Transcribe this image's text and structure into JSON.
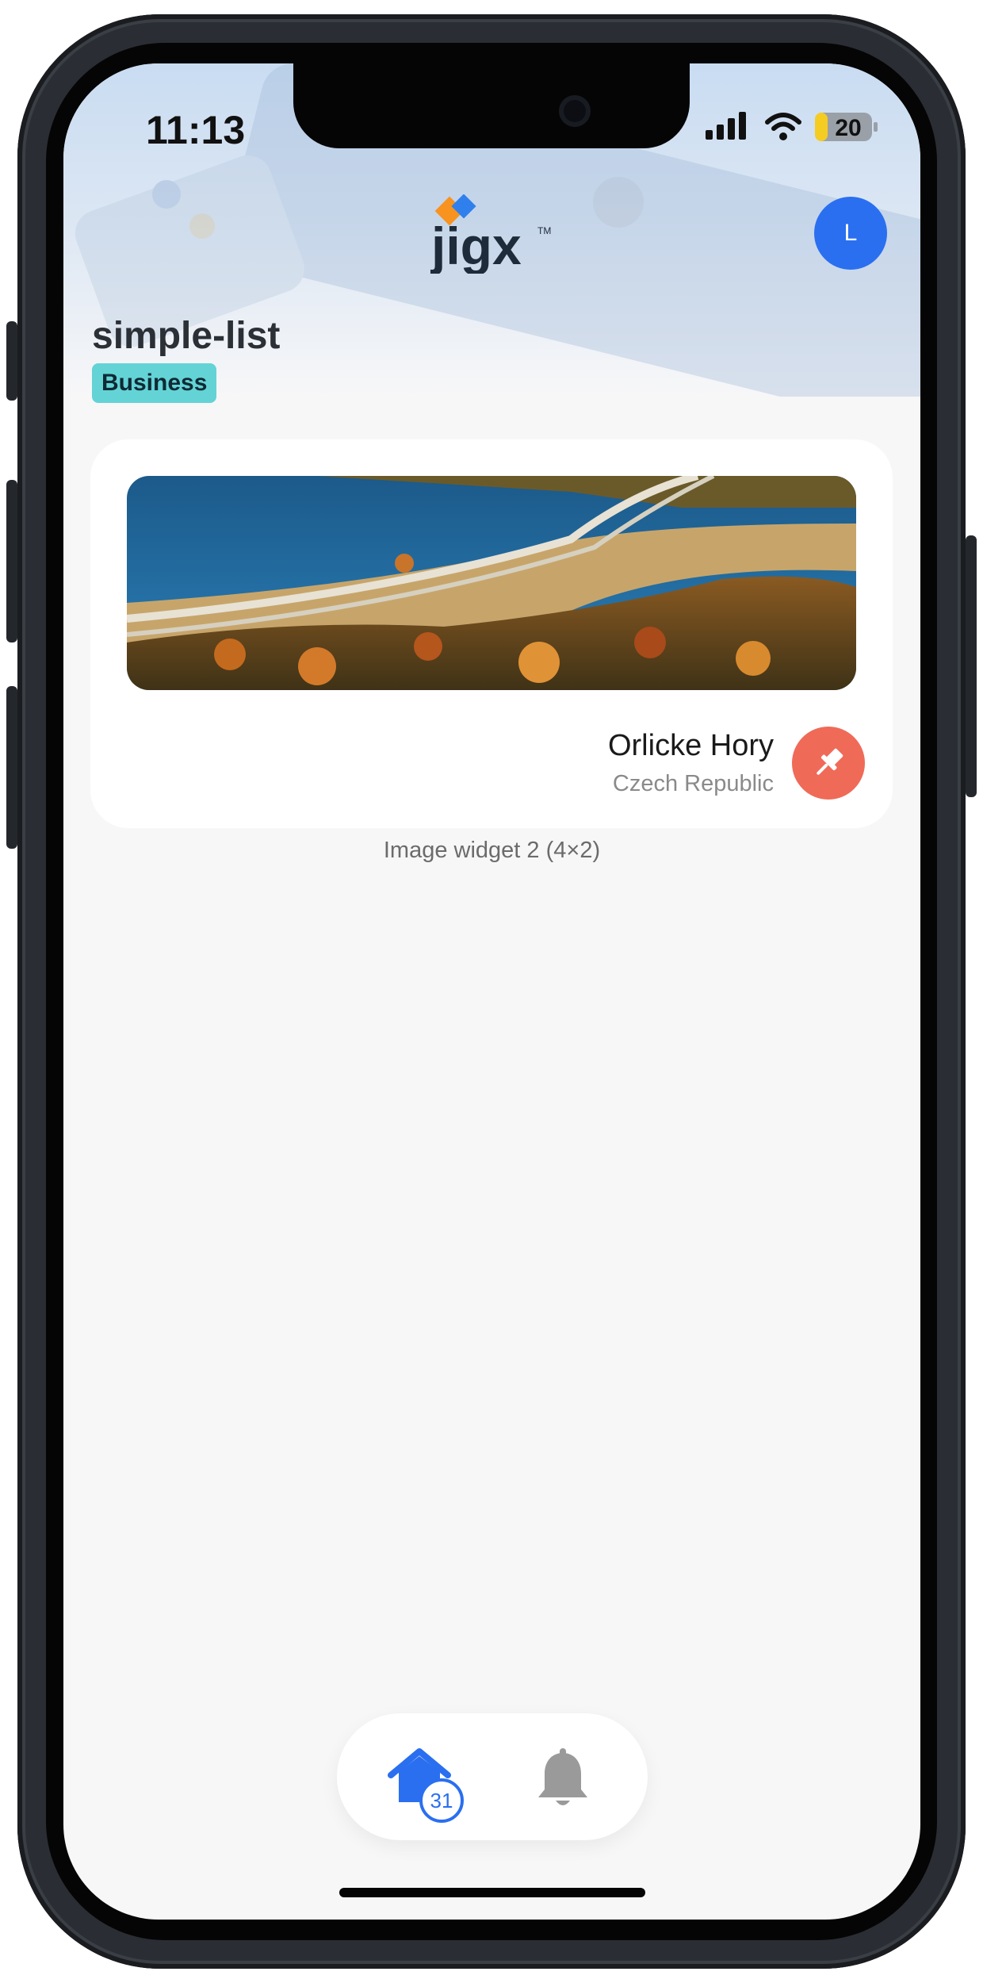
{
  "status_bar": {
    "time": "11:13",
    "battery_level": "20"
  },
  "header": {
    "avatar_initial": "L"
  },
  "page": {
    "title": "simple-list",
    "badge": "Business"
  },
  "card": {
    "title": "Orlicke Hory",
    "subtitle": "Czech Republic"
  },
  "caption": "Image widget 2 (4×2)",
  "tabbar": {
    "home_count": "31"
  },
  "colors": {
    "accent_blue": "#2a6ff0",
    "pin_red": "#f06a58",
    "badge_teal": "#63d3d6"
  }
}
